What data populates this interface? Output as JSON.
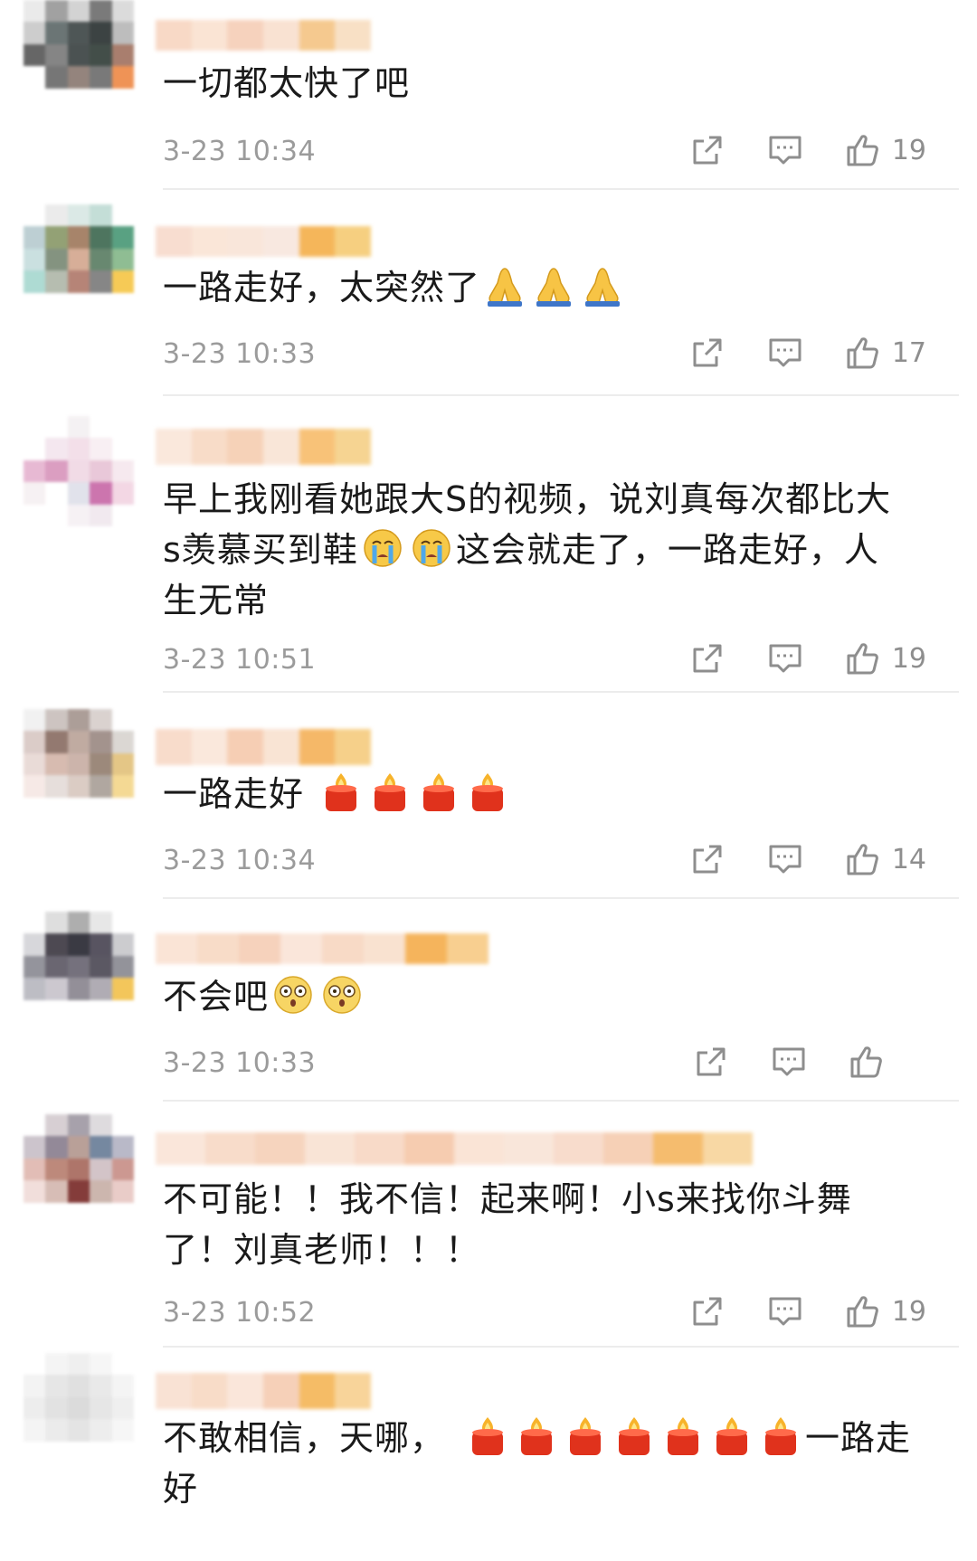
{
  "colors": {
    "text": "#1a1a1a",
    "meta": "#9b9b9b",
    "divider": "#ececec",
    "icon": "#8e8e8e"
  },
  "icons": {
    "share": "share-icon",
    "reply": "comment-icon",
    "like": "thumbs-up-icon"
  },
  "comments": [
    {
      "text_lines": [
        "一切都太快了吧"
      ],
      "time": "3-23 10:34",
      "likes": "19",
      "emojis": []
    },
    {
      "text_lines": [
        "一路走好，太突然了"
      ],
      "time": "3-23 10:33",
      "likes": "17",
      "emojis": [
        "pray-emoji",
        "pray-emoji",
        "pray-emoji"
      ]
    },
    {
      "text_lines": [
        "早上我刚看她跟大S的视频，说刘真每次都比大",
        "s羡慕买到鞋",
        "这会就走了，一路走好，人",
        "生无常"
      ],
      "time": "3-23 10:51",
      "likes": "19",
      "emojis": [
        "crying-emoji",
        "crying-emoji"
      ]
    },
    {
      "text_lines": [
        "一路走好"
      ],
      "time": "3-23 10:34",
      "likes": "14",
      "emojis": [
        "candle-emoji",
        "candle-emoji",
        "candle-emoji",
        "candle-emoji"
      ]
    },
    {
      "text_lines": [
        "不会吧"
      ],
      "time": "3-23 10:33",
      "likes": "",
      "emojis": [
        "shocked-emoji",
        "shocked-emoji"
      ]
    },
    {
      "text_lines": [
        "不可能！！我不信！起来啊！小s来找你斗舞",
        "了！刘真老师！！！"
      ],
      "time": "3-23 10:52",
      "likes": "19",
      "emojis": []
    },
    {
      "text_lines": [
        "不敢相信，天哪，",
        "一路走",
        "好"
      ],
      "time": "",
      "likes": "",
      "emojis": [
        "candle-emoji",
        "candle-emoji",
        "candle-emoji",
        "candle-emoji",
        "candle-emoji",
        "candle-emoji",
        "candle-emoji"
      ]
    }
  ]
}
